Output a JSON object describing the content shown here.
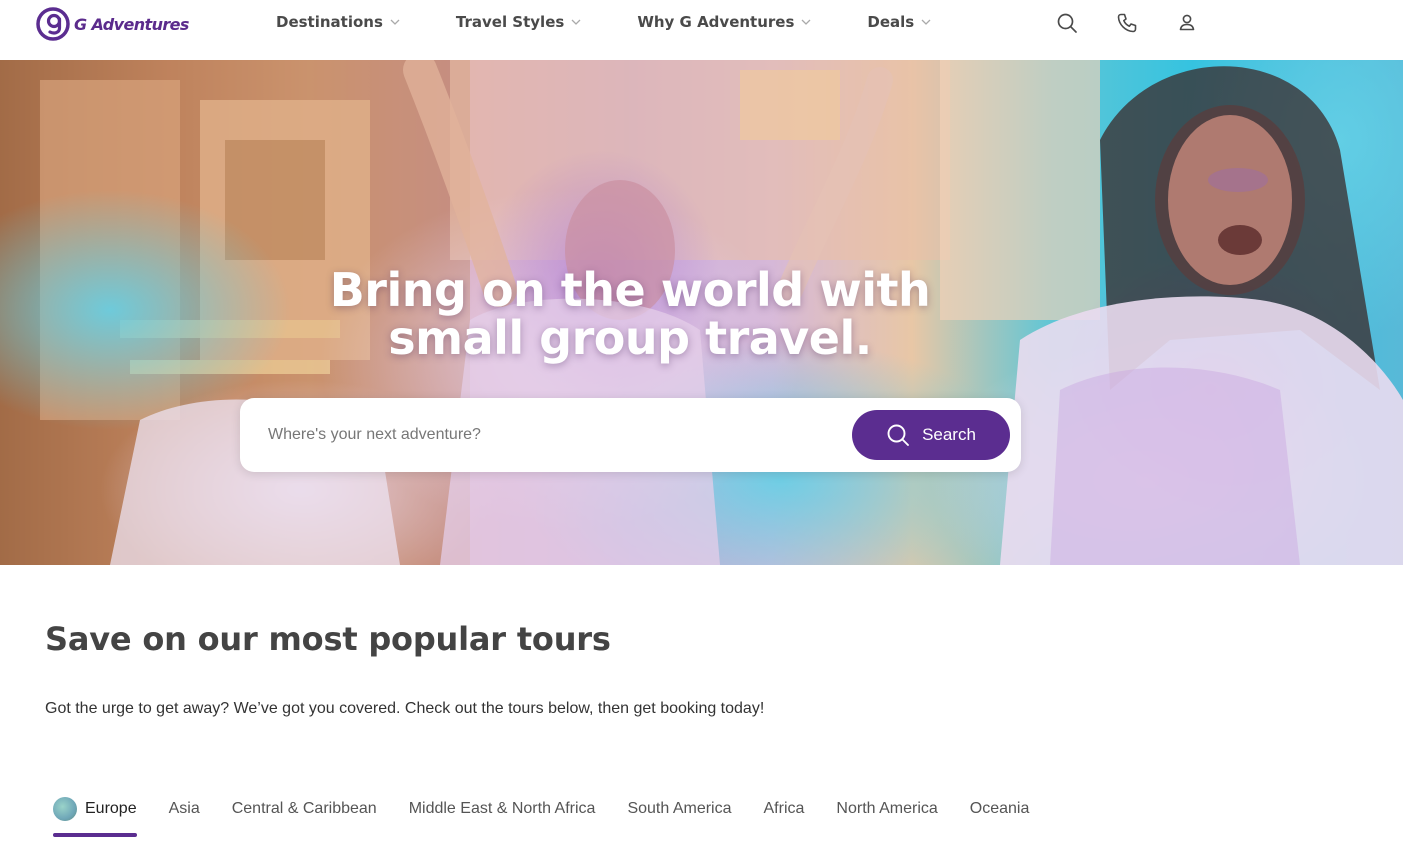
{
  "brand": {
    "name": "G Adventures",
    "color": "#5b2d90"
  },
  "nav": {
    "items": [
      {
        "label": "Destinations"
      },
      {
        "label": "Travel Styles"
      },
      {
        "label": "Why G Adventures"
      },
      {
        "label": "Deals"
      }
    ],
    "icons": [
      "search-icon",
      "phone-icon",
      "user-icon"
    ]
  },
  "hero": {
    "title_line1": "Bring on the world with",
    "title_line2": "small group travel.",
    "search": {
      "placeholder": "Where's your next adventure?",
      "value": "",
      "button_label": "Search"
    }
  },
  "section": {
    "title": "Save on our most popular tours",
    "description": "Got the urge to get away? We’ve got you covered. Check out the tours below, then get booking today!"
  },
  "tabs": {
    "active": "Europe",
    "items": [
      {
        "label": "Europe"
      },
      {
        "label": "Asia"
      },
      {
        "label": "Central & Caribbean"
      },
      {
        "label": "Middle East & North Africa"
      },
      {
        "label": "South America"
      },
      {
        "label": "Africa"
      },
      {
        "label": "North America"
      },
      {
        "label": "Oceania"
      }
    ]
  }
}
